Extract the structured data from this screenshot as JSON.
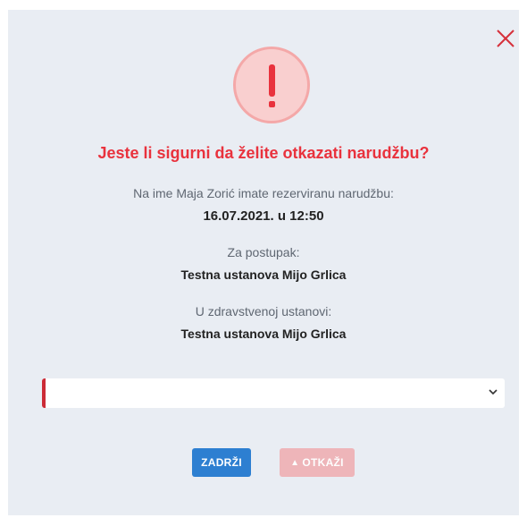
{
  "dialog": {
    "title": "Jeste li sigurni da želite otkazati narudžbu?",
    "reservation_intro": "Na ime Maja Zorić imate rezerviranu narudžbu:",
    "reservation_datetime": "16.07.2021. u 12:50",
    "procedure_label": "Za postupak:",
    "procedure_value": "Testna ustanova Mijo Grlica",
    "institution_label": "U zdravstvenoj ustanovi:",
    "institution_value": "Testna ustanova Mijo Grlica",
    "reason_select_value": "",
    "buttons": {
      "keep_label": "ZADRŽI",
      "cancel_label": "OTKAŽI",
      "cancel_icon": "warning-triangle-icon"
    },
    "close_icon": "close-icon",
    "alert_icon": "exclamation-icon"
  },
  "colors": {
    "modal_background": "#e9edf3",
    "danger": "#e9323d",
    "alert_circle_fill": "#f9cfcf",
    "primary_button": "#2d7fd1",
    "disabled_danger_button": "#efb3b6",
    "select_accent": "#cc2b36"
  }
}
